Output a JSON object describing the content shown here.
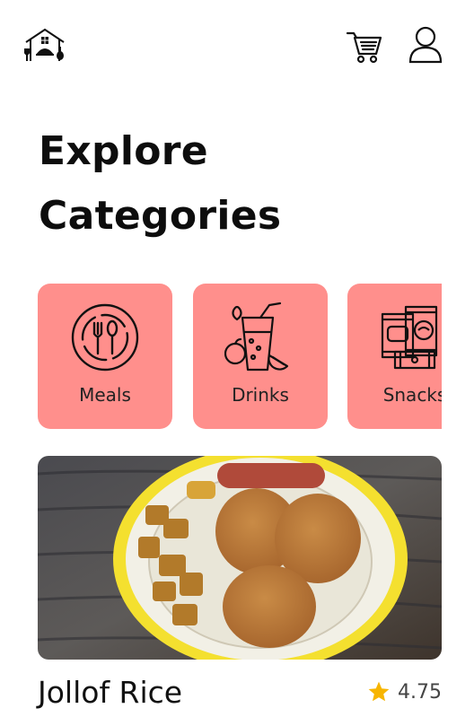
{
  "header": {
    "logo_icon": "home-dining-logo-icon",
    "cart_icon": "shopping-cart-icon",
    "profile_icon": "user-profile-icon"
  },
  "page": {
    "title_line1": "Explore",
    "title_line2": "Categories"
  },
  "categories": [
    {
      "label": "Meals",
      "icon": "meals-icon",
      "color": "#ff8f8c"
    },
    {
      "label": "Drinks",
      "icon": "drinks-icon",
      "color": "#ff8f8c"
    },
    {
      "label": "Snacks",
      "icon": "snacks-icon",
      "color": "#ff8f8c"
    }
  ],
  "featured": {
    "name": "Jollof Rice",
    "rating": "4.75",
    "rating_icon": "star-icon",
    "star_color": "#f7b500"
  }
}
